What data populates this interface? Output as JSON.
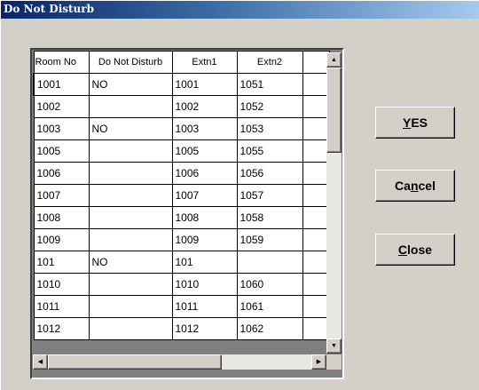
{
  "window": {
    "title": "Do Not Disturb"
  },
  "grid": {
    "columns": [
      "Room No",
      "Do Not Disturb",
      "Extn1",
      "Extn2",
      ""
    ],
    "rows": [
      [
        "1001",
        "NO",
        "1001",
        "1051"
      ],
      [
        "1002",
        "",
        "1002",
        "1052"
      ],
      [
        "1003",
        "NO",
        "1003",
        "1053"
      ],
      [
        "1005",
        "",
        "1005",
        "1055"
      ],
      [
        "1006",
        "",
        "1006",
        "1056"
      ],
      [
        "1007",
        "",
        "1007",
        "1057"
      ],
      [
        "1008",
        "",
        "1008",
        "1058"
      ],
      [
        "1009",
        "",
        "1009",
        "1059"
      ],
      [
        "101",
        "NO",
        "101",
        ""
      ],
      [
        "1010",
        "",
        "1010",
        "1060"
      ],
      [
        "1011",
        "",
        "1011",
        "1061"
      ],
      [
        "1012",
        "",
        "1012",
        "1062"
      ]
    ]
  },
  "buttons": {
    "yes": {
      "accel": "Y",
      "rest": "ES"
    },
    "cancel": {
      "pre": "Ca",
      "accel": "n",
      "rest": "cel"
    },
    "close": {
      "accel": "C",
      "rest": "lose"
    }
  },
  "icons": {
    "scroll_up": "triangle-up-icon",
    "scroll_down": "triangle-down-icon",
    "scroll_left": "triangle-left-icon",
    "scroll_right": "triangle-right-icon"
  },
  "colors": {
    "titlebar_start": "#0a246a",
    "titlebar_end": "#a6caf0",
    "face": "#d4d0c8"
  }
}
